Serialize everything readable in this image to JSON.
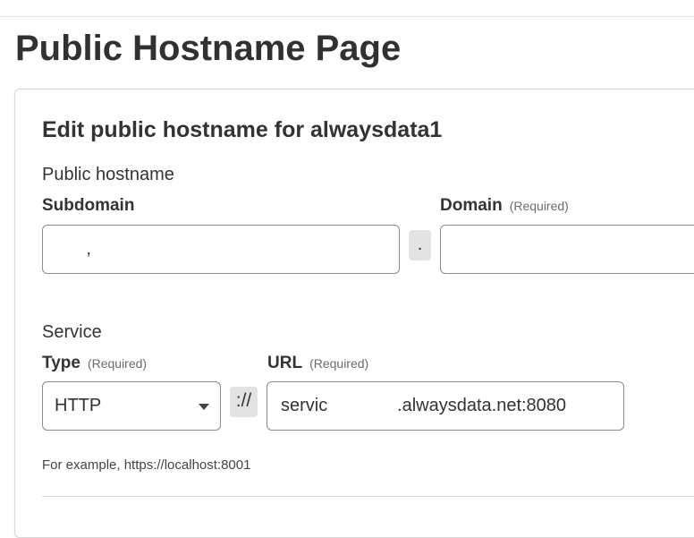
{
  "page": {
    "title": "Public Hostname Page"
  },
  "form": {
    "title": "Edit public hostname for alwaysdata1",
    "public_hostname": {
      "section_label": "Public hostname",
      "subdomain": {
        "label": "Subdomain",
        "value": "      ,"
      },
      "separator": ".",
      "domain": {
        "label": "Domain",
        "required_label": "(Required)",
        "value": ""
      }
    },
    "service": {
      "section_label": "Service",
      "type": {
        "label": "Type",
        "required_label": "(Required)",
        "value": "HTTP",
        "icon": "chevron-down-icon"
      },
      "separator": "://",
      "url": {
        "label": "URL",
        "required_label": "(Required)",
        "value": "servic              .alwaysdata.net:8080"
      },
      "hint": "For example, https://localhost:8001"
    }
  }
}
